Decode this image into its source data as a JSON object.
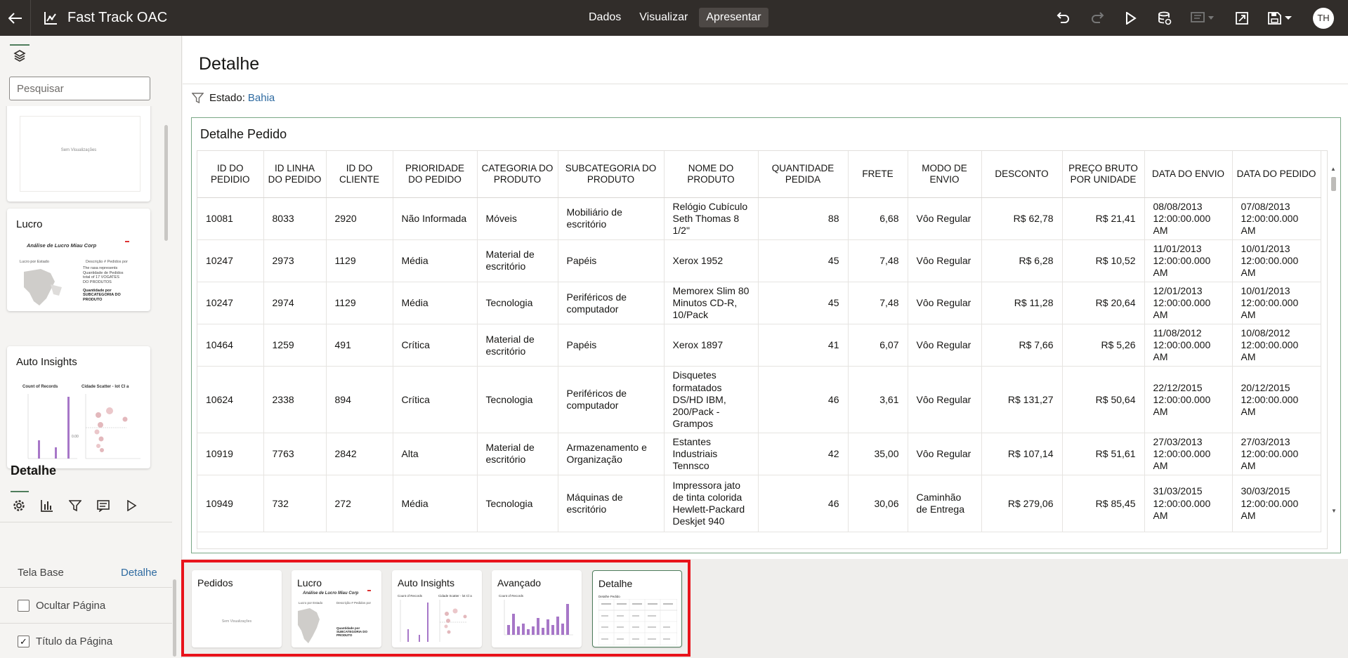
{
  "app": {
    "title": "Fast Track OAC"
  },
  "modes": [
    {
      "label": "Dados"
    },
    {
      "label": "Visualizar"
    },
    {
      "label": "Apresentar"
    }
  ],
  "user": {
    "initials": "TH"
  },
  "search": {
    "placeholder": "Pesquisar"
  },
  "thumbnails": [
    {
      "title": "",
      "caption": "Sem Visualizações"
    },
    {
      "title": "Lucro",
      "caption": "Análise de Lucro Miau Corp",
      "left_label": "Lucro por Estado",
      "right_label": "Descrição # Pedidos por",
      "note_lines": [
        "The rasa represents",
        "Quantidade de Pedidos",
        "total of 17 VOGATES",
        "DO PRODUTOS"
      ],
      "small_line1": "Quantidade por",
      "small_line2": "SUBCATEGORIA DO",
      "small_line3": "PRODUTO"
    },
    {
      "title": "Auto Insights",
      "left_label": "Count of Records",
      "right_label": "Cidade Scatter - lot Cl a",
      "y_tick": "0.00"
    }
  ],
  "section": {
    "title": "Detalhe",
    "base_label": "Tela Base",
    "base_value": "Detalhe",
    "hide_page": "Ocultar Página",
    "page_title": "Título da Página"
  },
  "page": {
    "title": "Detalhe",
    "filter_label": "Estado:",
    "filter_value": "Bahia"
  },
  "viz": {
    "title": "Detalhe Pedido",
    "columns": [
      "ID DO PEDIDIO",
      "ID LINHA DO PEDIDO",
      "ID DO CLIENTE",
      "PRIORIDADE DO PEDIDO",
      "CATEGORIA DO PRODUTO",
      "SUBCATEGORIA DO PRODUTO",
      "NOME DO PRODUTO",
      "QUANTIDADE PEDIDA",
      "FRETE",
      "MODO DE ENVIO",
      "DESCONTO",
      "PREÇO BRUTO POR UNIDADE",
      "DATA DO ENVIO",
      "DATA DO PEDIDO"
    ],
    "rows": [
      [
        "10081",
        "8033",
        "2920",
        "Não Informada",
        "Móveis",
        "Mobiliário de escritório",
        "Relógio Cubículo Seth Thomas 8 1/2\"",
        "88",
        "6,68",
        "Vôo Regular",
        "R$ 62,78",
        "R$ 21,41",
        "08/08/2013 12:00:00.000 AM",
        "07/08/2013 12:00:00.000 AM"
      ],
      [
        "10247",
        "2973",
        "1129",
        "Média",
        "Material de escritório",
        "Papéis",
        "Xerox 1952",
        "45",
        "7,48",
        "Vôo Regular",
        "R$ 6,28",
        "R$ 10,52",
        "11/01/2013 12:00:00.000 AM",
        "10/01/2013 12:00:00.000 AM"
      ],
      [
        "10247",
        "2974",
        "1129",
        "Média",
        "Tecnologia",
        "Periféricos de computador",
        "Memorex Slim 80 Minutos CD-R, 10/Pack",
        "45",
        "7,48",
        "Vôo Regular",
        "R$ 11,28",
        "R$ 20,64",
        "12/01/2013 12:00:00.000 AM",
        "10/01/2013 12:00:00.000 AM"
      ],
      [
        "10464",
        "1259",
        "491",
        "Crítica",
        "Material de escritório",
        "Papéis",
        "Xerox 1897",
        "41",
        "6,07",
        "Vôo Regular",
        "R$ 7,66",
        "R$ 5,26",
        "11/08/2012 12:00:00.000 AM",
        "10/08/2012 12:00:00.000 AM"
      ],
      [
        "10624",
        "2338",
        "894",
        "Crítica",
        "Tecnologia",
        "Periféricos de computador",
        "Disquetes formatados DS/HD IBM, 200/Pack - Grampos",
        "46",
        "3,61",
        "Vôo Regular",
        "R$ 131,27",
        "R$ 50,64",
        "22/12/2015 12:00:00.000 AM",
        "20/12/2015 12:00:00.000 AM"
      ],
      [
        "10919",
        "7763",
        "2842",
        "Alta",
        "Material de escritório",
        "Armazenamento e Organização",
        "Estantes Industriais Tennsco",
        "42",
        "35,00",
        "Vôo Regular",
        "R$ 107,14",
        "R$ 51,61",
        "27/03/2013 12:00:00.000 AM",
        "27/03/2013 12:00:00.000 AM"
      ],
      [
        "10949",
        "732",
        "272",
        "Média",
        "Tecnologia",
        "Máquinas de escritório",
        "Impressora jato de tinta colorida Hewlett-Packard Deskjet 940",
        "46",
        "30,06",
        "Caminhão de Entrega",
        "R$ 279,06",
        "R$ 85,45",
        "31/03/2015 12:00:00.000 AM",
        "30/03/2015 12:00:00.000 AM"
      ]
    ]
  },
  "pages": [
    {
      "title": "Pedidos",
      "caption": "Sem Visualizações"
    },
    {
      "title": "Lucro",
      "caption": "Análise de Lucro Miau Corp",
      "left_label": "Lucro por Estado",
      "right_label": "Descrição # Pedidos por",
      "small_line1": "Quantidade por",
      "small_line2": "SUBCATEGORIA DO",
      "small_line3": "PRODUTO"
    },
    {
      "title": "Auto Insights",
      "left_label": "Count of Records",
      "right_label": "Cidade Scatter - lot Cl a"
    },
    {
      "title": "Avançado",
      "left_label": "Count of Records"
    },
    {
      "title": "Detalhe",
      "left_label": "Detalhe Pedido"
    }
  ],
  "colors": {
    "topbar": "#312d2a",
    "accent_green": "#4f7d5c",
    "link_blue": "#2f6ba1",
    "highlight_red": "#e8131b",
    "bar_purple": "#a777c8"
  }
}
